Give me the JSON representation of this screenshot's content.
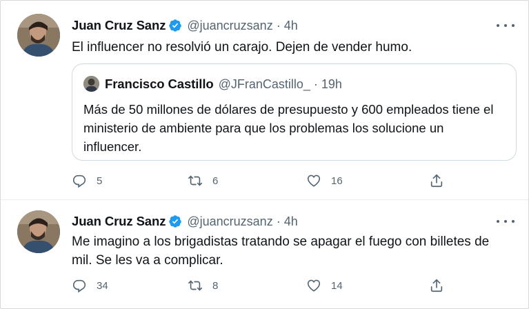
{
  "tweets": [
    {
      "author_name": "Juan Cruz Sanz",
      "handle": "@juancruzsanz",
      "separator": "·",
      "time": "4h",
      "text": "El influencer no resolvió un carajo. Dejen de vender humo.",
      "quote": {
        "author_name": "Francisco Castillo",
        "handle": "@JFranCastillo_",
        "separator": "·",
        "time": "19h",
        "text": "Más de 50 millones de dólares de presupuesto y 600 empleados tiene el ministerio de ambiente para que los problemas los solucione un influencer."
      },
      "replies": "5",
      "retweets": "6",
      "likes": "16"
    },
    {
      "author_name": "Juan Cruz Sanz",
      "handle": "@juancruzsanz",
      "separator": "·",
      "time": "4h",
      "text": "Me imagino a los brigadistas tratando se apagar el fuego con billetes de mil. Se les va a complicar.",
      "replies": "34",
      "retweets": "8",
      "likes": "14"
    }
  ],
  "colors": {
    "text_primary": "#0f1419",
    "text_secondary": "#536471",
    "verified_blue": "#1d9bf0",
    "border": "#cfd9de",
    "divider": "#e6ecf0"
  },
  "icons": [
    "verified-badge-icon",
    "more-options-icon",
    "reply-icon",
    "retweet-icon",
    "like-icon",
    "share-icon"
  ]
}
